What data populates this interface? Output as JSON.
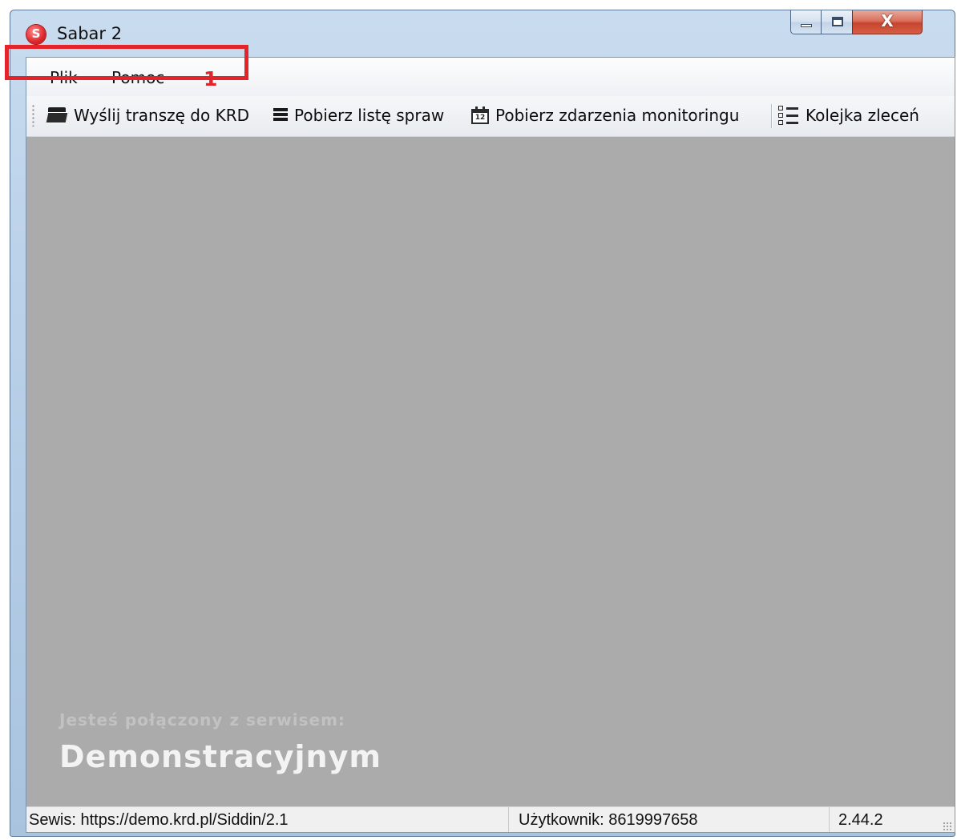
{
  "window": {
    "title": "Sabar 2",
    "close_glyph": "X",
    "app_icon": "sabar-logo-icon"
  },
  "menu": {
    "items": [
      {
        "label": "Plik"
      },
      {
        "label": "Pomoc"
      }
    ]
  },
  "annotation": {
    "number": "1",
    "color": "#e3252b"
  },
  "toolbar": {
    "buttons": [
      {
        "label": "Wyślij transzę do KRD",
        "icon": "folder-icon"
      },
      {
        "label": "Pobierz listę spraw",
        "icon": "list-icon"
      },
      {
        "label": "Pobierz zdarzenia monitoringu",
        "icon": "calendar-icon",
        "icon_text": "12"
      },
      {
        "label": "Kolejka zleceń",
        "icon": "queue-icon"
      }
    ]
  },
  "workspace": {
    "connection_label": "Jesteś połączony z serwisem:",
    "connection_value": "Demonstracyjnym",
    "background": "#ababab"
  },
  "statusbar": {
    "service": "Sewis: https://demo.krd.pl/Siddin/2.1",
    "user": "Użytkownik: 8619997658",
    "version": "2.44.2"
  }
}
